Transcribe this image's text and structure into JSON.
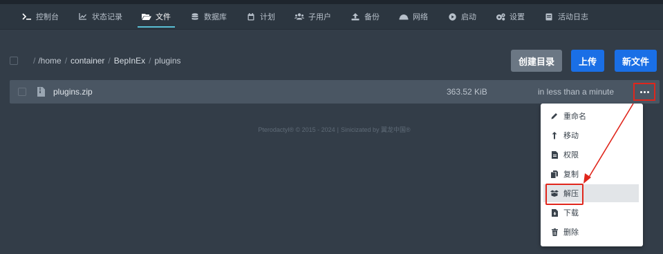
{
  "nav": {
    "items": [
      {
        "label": "控制台",
        "icon": "terminal-icon"
      },
      {
        "label": "状态记录",
        "icon": "chart-line-icon"
      },
      {
        "label": "文件",
        "icon": "folder-open-icon",
        "active": true
      },
      {
        "label": "数据库",
        "icon": "database-icon"
      },
      {
        "label": "计划",
        "icon": "calendar-icon"
      },
      {
        "label": "子用户",
        "icon": "users-icon"
      },
      {
        "label": "备份",
        "icon": "upload-icon"
      },
      {
        "label": "网络",
        "icon": "network-icon"
      },
      {
        "label": "启动",
        "icon": "play-circle-icon"
      },
      {
        "label": "设置",
        "icon": "cogs-icon"
      },
      {
        "label": "活动日志",
        "icon": "log-icon"
      }
    ]
  },
  "breadcrumb": {
    "root": "/home",
    "segments": [
      "container",
      "BepInEx",
      "plugins"
    ]
  },
  "toolbar": {
    "create_dir": "创建目录",
    "upload": "上传",
    "new_file": "新文件"
  },
  "files": [
    {
      "name": "plugins.zip",
      "size": "363.52 KiB",
      "modified": "in less than a minute"
    }
  ],
  "footer": {
    "left": "Pterodactyl® © 2015 - 2024",
    "right": "Sinicizated by 翼龙中国®"
  },
  "context_menu": {
    "items": [
      {
        "label": "重命名",
        "icon": "pencil-icon"
      },
      {
        "label": "移动",
        "icon": "level-up-icon"
      },
      {
        "label": "权限",
        "icon": "file-icon"
      },
      {
        "label": "复制",
        "icon": "copy-icon"
      },
      {
        "label": "解压",
        "icon": "box-open-icon",
        "highlighted": true
      },
      {
        "label": "下载",
        "icon": "file-download-icon"
      },
      {
        "label": "删除",
        "icon": "trash-icon"
      }
    ]
  },
  "colors": {
    "accent": "#1a6fe6",
    "annotation": "#e0261c",
    "nav_active_underline": "#59c0d6"
  }
}
